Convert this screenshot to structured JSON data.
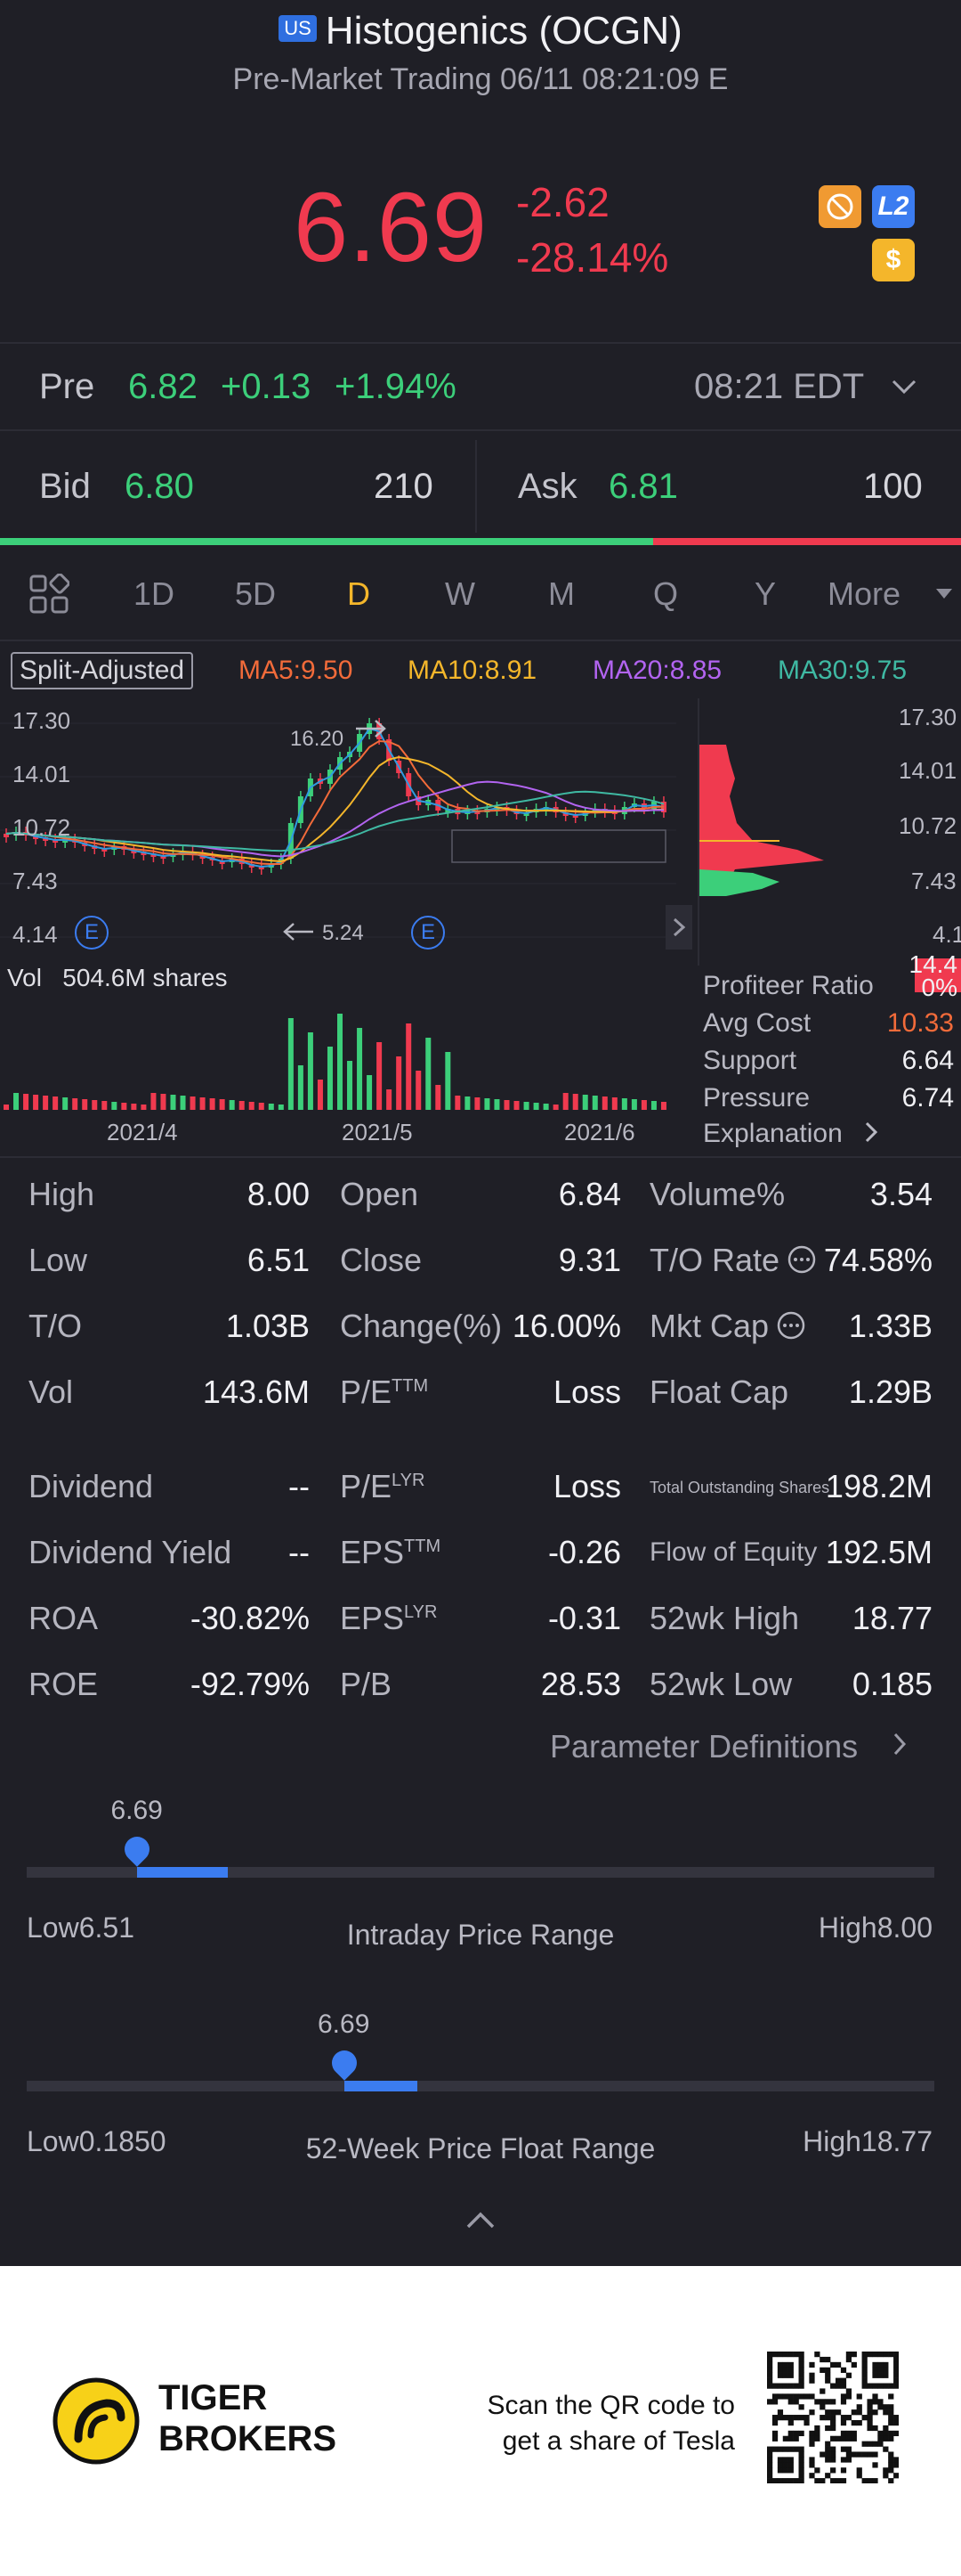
{
  "header": {
    "market_badge": "US",
    "title": "Histogenics (OCGN)",
    "subtitle": "Pre-Market Trading 06/11 08:21:09 E"
  },
  "quote": {
    "price": "6.69",
    "change": "-2.62",
    "change_pct": "-28.14%",
    "badge_l2": "L2",
    "badge_dollar": "$"
  },
  "pre": {
    "label": "Pre",
    "price": "6.82",
    "change": "+0.13",
    "change_pct": "+1.94%",
    "time": "08:21 EDT"
  },
  "bidask": {
    "bid_label": "Bid",
    "bid": "6.80",
    "bid_size": "210",
    "ask_label": "Ask",
    "ask": "6.81",
    "ask_size": "100",
    "bid_ratio": 0.68
  },
  "tabs": [
    "1D",
    "5D",
    "D",
    "W",
    "M",
    "Q",
    "Y"
  ],
  "tab_active": "D",
  "tab_more": "More",
  "chart": {
    "split_label": "Split-Adjusted",
    "ma5": "MA5:9.50",
    "ma10": "MA10:8.91",
    "ma20": "MA20:8.85",
    "ma30": "MA30:9.75",
    "y_left": [
      "17.30",
      "14.01",
      "10.72",
      "7.43",
      "4.14"
    ],
    "y_right": [
      "17.30",
      "14.01",
      "10.72",
      "7.43",
      "4.14"
    ],
    "high_marker": "16.20",
    "low_marker": "5.24",
    "event_label": "E",
    "vol_label": "Vol",
    "vol_value": "504.6M shares",
    "x_labels": [
      "2021/4",
      "2021/5",
      "2021/6"
    ],
    "colors": {
      "up": "#3ccf7a",
      "down": "#f03a4f",
      "ma5": "#f26b3a",
      "ma10": "#f4b62b",
      "ma20": "#b264f0",
      "ma30": "#3fb9a3",
      "line": "#2f9be0"
    }
  },
  "chip": {
    "ratio_label": "Profiteer Ratio",
    "ratio_value": "14.40%",
    "avg_label": "Avg Cost",
    "avg_value": "10.33",
    "support_label": "Support",
    "support_value": "6.64",
    "pressure_label": "Pressure",
    "pressure_value": "6.74",
    "explanation": "Explanation"
  },
  "stats": [
    [
      "High",
      "8.00",
      "Open",
      "6.84",
      "Volume%",
      "3.54"
    ],
    [
      "Low",
      "6.51",
      "Close",
      "9.31",
      "T/O Rate",
      "74.58%"
    ],
    [
      "T/O",
      "1.03B",
      "Change(%)",
      "16.00%",
      "Mkt Cap",
      "1.33B"
    ],
    [
      "Vol",
      "143.6M",
      "P/E",
      "Loss",
      "Float Cap",
      "1.29B"
    ]
  ],
  "stats2": [
    [
      "Dividend",
      "--",
      "P/E",
      "Loss",
      "Total Outstanding Shares",
      "198.2M"
    ],
    [
      "Dividend Yield",
      "--",
      "EPS",
      "-0.26",
      "Flow of Equity",
      "192.5M"
    ],
    [
      "ROA",
      "-30.82%",
      "EPS",
      "-0.31",
      "52wk High",
      "18.77"
    ],
    [
      "ROE",
      "-92.79%",
      "P/B",
      "28.53",
      "52wk Low",
      "0.185"
    ]
  ],
  "sup": {
    "ttm": "TTM",
    "lyr": "LYR"
  },
  "param_link": "Parameter Definitions",
  "intraday": {
    "value": "6.69",
    "low": "Low6.51",
    "high": "High8.00",
    "title": "Intraday Price Range",
    "pos": 0.122
  },
  "week52": {
    "value": "6.69",
    "low": "Low0.1850",
    "high": "High18.77",
    "title": "52-Week Price Float Range",
    "pos": 0.35
  },
  "footer": {
    "brand_line1": "TIGER",
    "brand_line2": "BROKERS",
    "cta_line1": "Scan the QR code to",
    "cta_line2": "get a share of Tesla"
  }
}
